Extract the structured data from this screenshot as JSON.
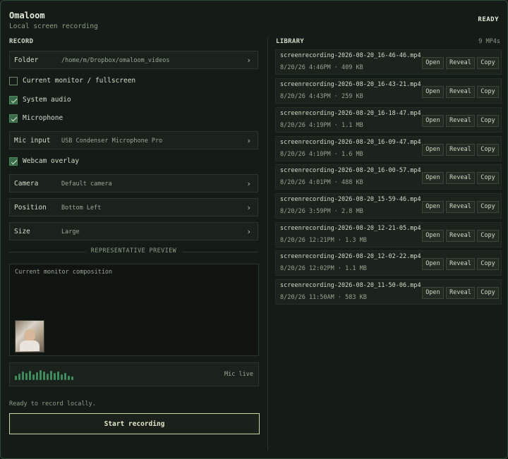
{
  "app": {
    "title": "Omaloom",
    "subtitle": "Local screen recording",
    "status": "READY"
  },
  "record": {
    "section_label": "RECORD",
    "folder": {
      "label": "Folder",
      "value": "/home/m/Dropbox/omaloom_videos"
    },
    "current_monitor": {
      "label": "Current monitor / fullscreen",
      "checked": false
    },
    "system_audio": {
      "label": "System audio",
      "checked": true
    },
    "microphone": {
      "label": "Microphone",
      "checked": true
    },
    "mic_input": {
      "label": "Mic input",
      "value": "USB Condenser Microphone Pro"
    },
    "webcam_overlay": {
      "label": "Webcam overlay",
      "checked": true
    },
    "camera": {
      "label": "Camera",
      "value": "Default camera"
    },
    "position": {
      "label": "Position",
      "value": "Bottom Left"
    },
    "size": {
      "label": "Size",
      "value": "Large"
    },
    "chevron": "›"
  },
  "preview": {
    "heading": "REPRESENTATIVE PREVIEW",
    "text": "Current monitor composition"
  },
  "mic": {
    "label": "Mic live"
  },
  "footer": {
    "ready_text": "Ready to record locally.",
    "start_label": "Start recording"
  },
  "library": {
    "section_label": "LIBRARY",
    "count": "9 MP4s",
    "buttons": {
      "open": "Open",
      "reveal": "Reveal",
      "copy": "Copy"
    },
    "items": [
      {
        "name": "screenrecording-2026-08-20_16-46-46.mp4",
        "meta": "8/20/26 4:46PM · 409 KB"
      },
      {
        "name": "screenrecording-2026-08-20_16-43-21.mp4",
        "meta": "8/20/26 4:43PM · 259 KB"
      },
      {
        "name": "screenrecording-2026-08-20_16-18-47.mp4",
        "meta": "8/20/26 4:19PM · 1.1 MB"
      },
      {
        "name": "screenrecording-2026-08-20_16-09-47.mp4",
        "meta": "8/20/26 4:10PM · 1.6 MB"
      },
      {
        "name": "screenrecording-2026-08-20_16-00-57.mp4",
        "meta": "8/20/26 4:01PM · 488 KB"
      },
      {
        "name": "screenrecording-2026-08-20_15-59-46.mp4",
        "meta": "8/20/26 3:59PM · 2.8 MB"
      },
      {
        "name": "screenrecording-2026-08-20_12-21-05.mp4",
        "meta": "8/20/26 12:21PM · 1.3 MB"
      },
      {
        "name": "screenrecording-2026-08-20_12-02-22.mp4",
        "meta": "8/20/26 12:02PM · 1.1 MB"
      },
      {
        "name": "screenrecording-2026-08-20_11-50-06.mp4",
        "meta": "8/20/26 11:50AM · 583 KB"
      }
    ]
  },
  "colors": {
    "accent": "#3f8a5c",
    "background": "#151b16",
    "check_on": "#3b6a48"
  }
}
